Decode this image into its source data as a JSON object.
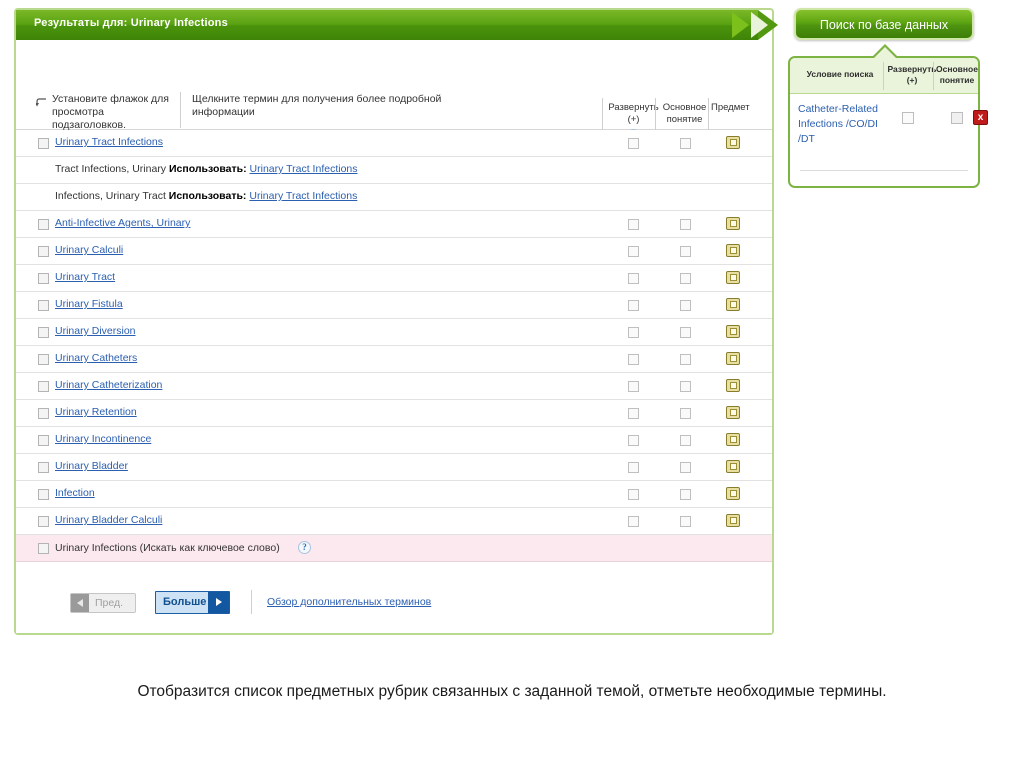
{
  "header": {
    "title": "Результаты для: Urinary Infections"
  },
  "instructions": {
    "left": "Установите флажок для просмотра подзаголовков.",
    "right": "Щелкните термин для получения более подробной информации",
    "columns": {
      "expand": "Развернуть",
      "expand_sub": "(+)",
      "major": "Основное",
      "major_sub": "понятие",
      "scope": "Предмет",
      "help_icon": "?"
    }
  },
  "rows": [
    {
      "type": "term",
      "label": "Urinary Tract Infections",
      "checkbox": true,
      "cells": true
    },
    {
      "type": "usefor",
      "prefix": "Tract Infections, Urinary",
      "use_label": "Использовать:",
      "link": "Urinary Tract Infections"
    },
    {
      "type": "usefor",
      "prefix": "Infections, Urinary Tract",
      "use_label": "Использовать:",
      "link": "Urinary Tract Infections"
    },
    {
      "type": "term",
      "label": "Anti-Infective Agents, Urinary",
      "checkbox": true,
      "cells": true
    },
    {
      "type": "term",
      "label": "Urinary Calculi",
      "checkbox": true,
      "cells": true
    },
    {
      "type": "term",
      "label": "Urinary Tract",
      "checkbox": true,
      "cells": true
    },
    {
      "type": "term",
      "label": "Urinary Fistula",
      "checkbox": true,
      "cells": true
    },
    {
      "type": "term",
      "label": "Urinary Diversion",
      "checkbox": true,
      "cells": true
    },
    {
      "type": "term",
      "label": "Urinary Catheters",
      "checkbox": true,
      "cells": true
    },
    {
      "type": "term",
      "label": "Urinary Catheterization",
      "checkbox": true,
      "cells": true
    },
    {
      "type": "term",
      "label": "Urinary Retention",
      "checkbox": true,
      "cells": true
    },
    {
      "type": "term",
      "label": "Urinary Incontinence",
      "checkbox": true,
      "cells": true
    },
    {
      "type": "term",
      "label": "Urinary Bladder",
      "checkbox": true,
      "cells": true
    },
    {
      "type": "term",
      "label": "Infection",
      "checkbox": true,
      "cells": true
    },
    {
      "type": "term",
      "label": "Urinary Bladder Calculi",
      "checkbox": true,
      "cells": true
    },
    {
      "type": "keyword",
      "label": "Urinary Infections (Искать как ключевое слово)",
      "checkbox": true,
      "help_icon": "?"
    }
  ],
  "footer": {
    "prev_label": "Пред.",
    "more_label": "Больше",
    "review_link": "Обзор дополнительных терминов"
  },
  "callout": {
    "button_label": "Поиск по базе данных",
    "panel": {
      "col_condition": "Условие поиска",
      "col_expand": "Развернуть",
      "col_expand_sub": "(+)",
      "col_major": "Основное",
      "col_major_sub": "понятие",
      "term": "Catheter-Related Infections /CO/DI /DT",
      "remove_label": "x"
    }
  },
  "caption": "Отобразится список предметных рубрик связанных с заданной темой, отметьте необходимые термины.",
  "colors": {
    "green_bar": "#59a211",
    "panel_border": "#b9d98f",
    "link_blue": "#2b5fb0",
    "keyword_row_bg": "#fbe9ef",
    "remove_red": "#c01b1b",
    "more_button_blue": "#1257a0"
  }
}
